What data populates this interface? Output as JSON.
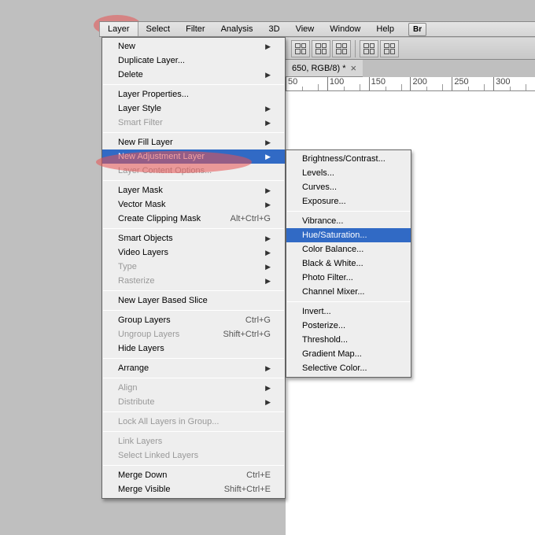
{
  "menubar": {
    "items": [
      "Layer",
      "Select",
      "Filter",
      "Analysis",
      "3D",
      "View",
      "Window",
      "Help"
    ],
    "br": "Br"
  },
  "docTab": {
    "title": "650, RGB/8) *"
  },
  "ruler": {
    "ticks": [
      "50",
      "100",
      "150",
      "200",
      "250",
      "300"
    ]
  },
  "layerMenu": [
    {
      "label": "New",
      "arrow": true
    },
    {
      "label": "Duplicate Layer...",
      "arrow": false
    },
    {
      "label": "Delete",
      "arrow": true
    },
    {
      "sep": true
    },
    {
      "label": "Layer Properties...",
      "arrow": false
    },
    {
      "label": "Layer Style",
      "arrow": true
    },
    {
      "label": "Smart Filter",
      "arrow": true,
      "disabled": true
    },
    {
      "sep": true
    },
    {
      "label": "New Fill Layer",
      "arrow": true
    },
    {
      "label": "New Adjustment Layer",
      "arrow": true,
      "selected": true
    },
    {
      "label": "Layer Content Options...",
      "arrow": false,
      "disabled": true
    },
    {
      "sep": true
    },
    {
      "label": "Layer Mask",
      "arrow": true
    },
    {
      "label": "Vector Mask",
      "arrow": true
    },
    {
      "label": "Create Clipping Mask",
      "shortcut": "Alt+Ctrl+G"
    },
    {
      "sep": true
    },
    {
      "label": "Smart Objects",
      "arrow": true
    },
    {
      "label": "Video Layers",
      "arrow": true
    },
    {
      "label": "Type",
      "arrow": true,
      "disabled": true
    },
    {
      "label": "Rasterize",
      "arrow": true,
      "disabled": true
    },
    {
      "sep": true
    },
    {
      "label": "New Layer Based Slice"
    },
    {
      "sep": true
    },
    {
      "label": "Group Layers",
      "shortcut": "Ctrl+G"
    },
    {
      "label": "Ungroup Layers",
      "shortcut": "Shift+Ctrl+G",
      "disabled": true
    },
    {
      "label": "Hide Layers"
    },
    {
      "sep": true
    },
    {
      "label": "Arrange",
      "arrow": true
    },
    {
      "sep": true
    },
    {
      "label": "Align",
      "arrow": true,
      "disabled": true
    },
    {
      "label": "Distribute",
      "arrow": true,
      "disabled": true
    },
    {
      "sep": true
    },
    {
      "label": "Lock All Layers in Group...",
      "disabled": true
    },
    {
      "sep": true
    },
    {
      "label": "Link Layers",
      "disabled": true
    },
    {
      "label": "Select Linked Layers",
      "disabled": true
    },
    {
      "sep": true
    },
    {
      "label": "Merge Down",
      "shortcut": "Ctrl+E"
    },
    {
      "label": "Merge Visible",
      "shortcut": "Shift+Ctrl+E"
    }
  ],
  "adjustMenu": [
    {
      "label": "Brightness/Contrast..."
    },
    {
      "label": "Levels..."
    },
    {
      "label": "Curves..."
    },
    {
      "label": "Exposure..."
    },
    {
      "sep": true
    },
    {
      "label": "Vibrance..."
    },
    {
      "label": "Hue/Saturation...",
      "selected": true
    },
    {
      "label": "Color Balance..."
    },
    {
      "label": "Black & White..."
    },
    {
      "label": "Photo Filter..."
    },
    {
      "label": "Channel Mixer..."
    },
    {
      "sep": true
    },
    {
      "label": "Invert..."
    },
    {
      "label": "Posterize..."
    },
    {
      "label": "Threshold..."
    },
    {
      "label": "Gradient Map..."
    },
    {
      "label": "Selective Color..."
    }
  ]
}
